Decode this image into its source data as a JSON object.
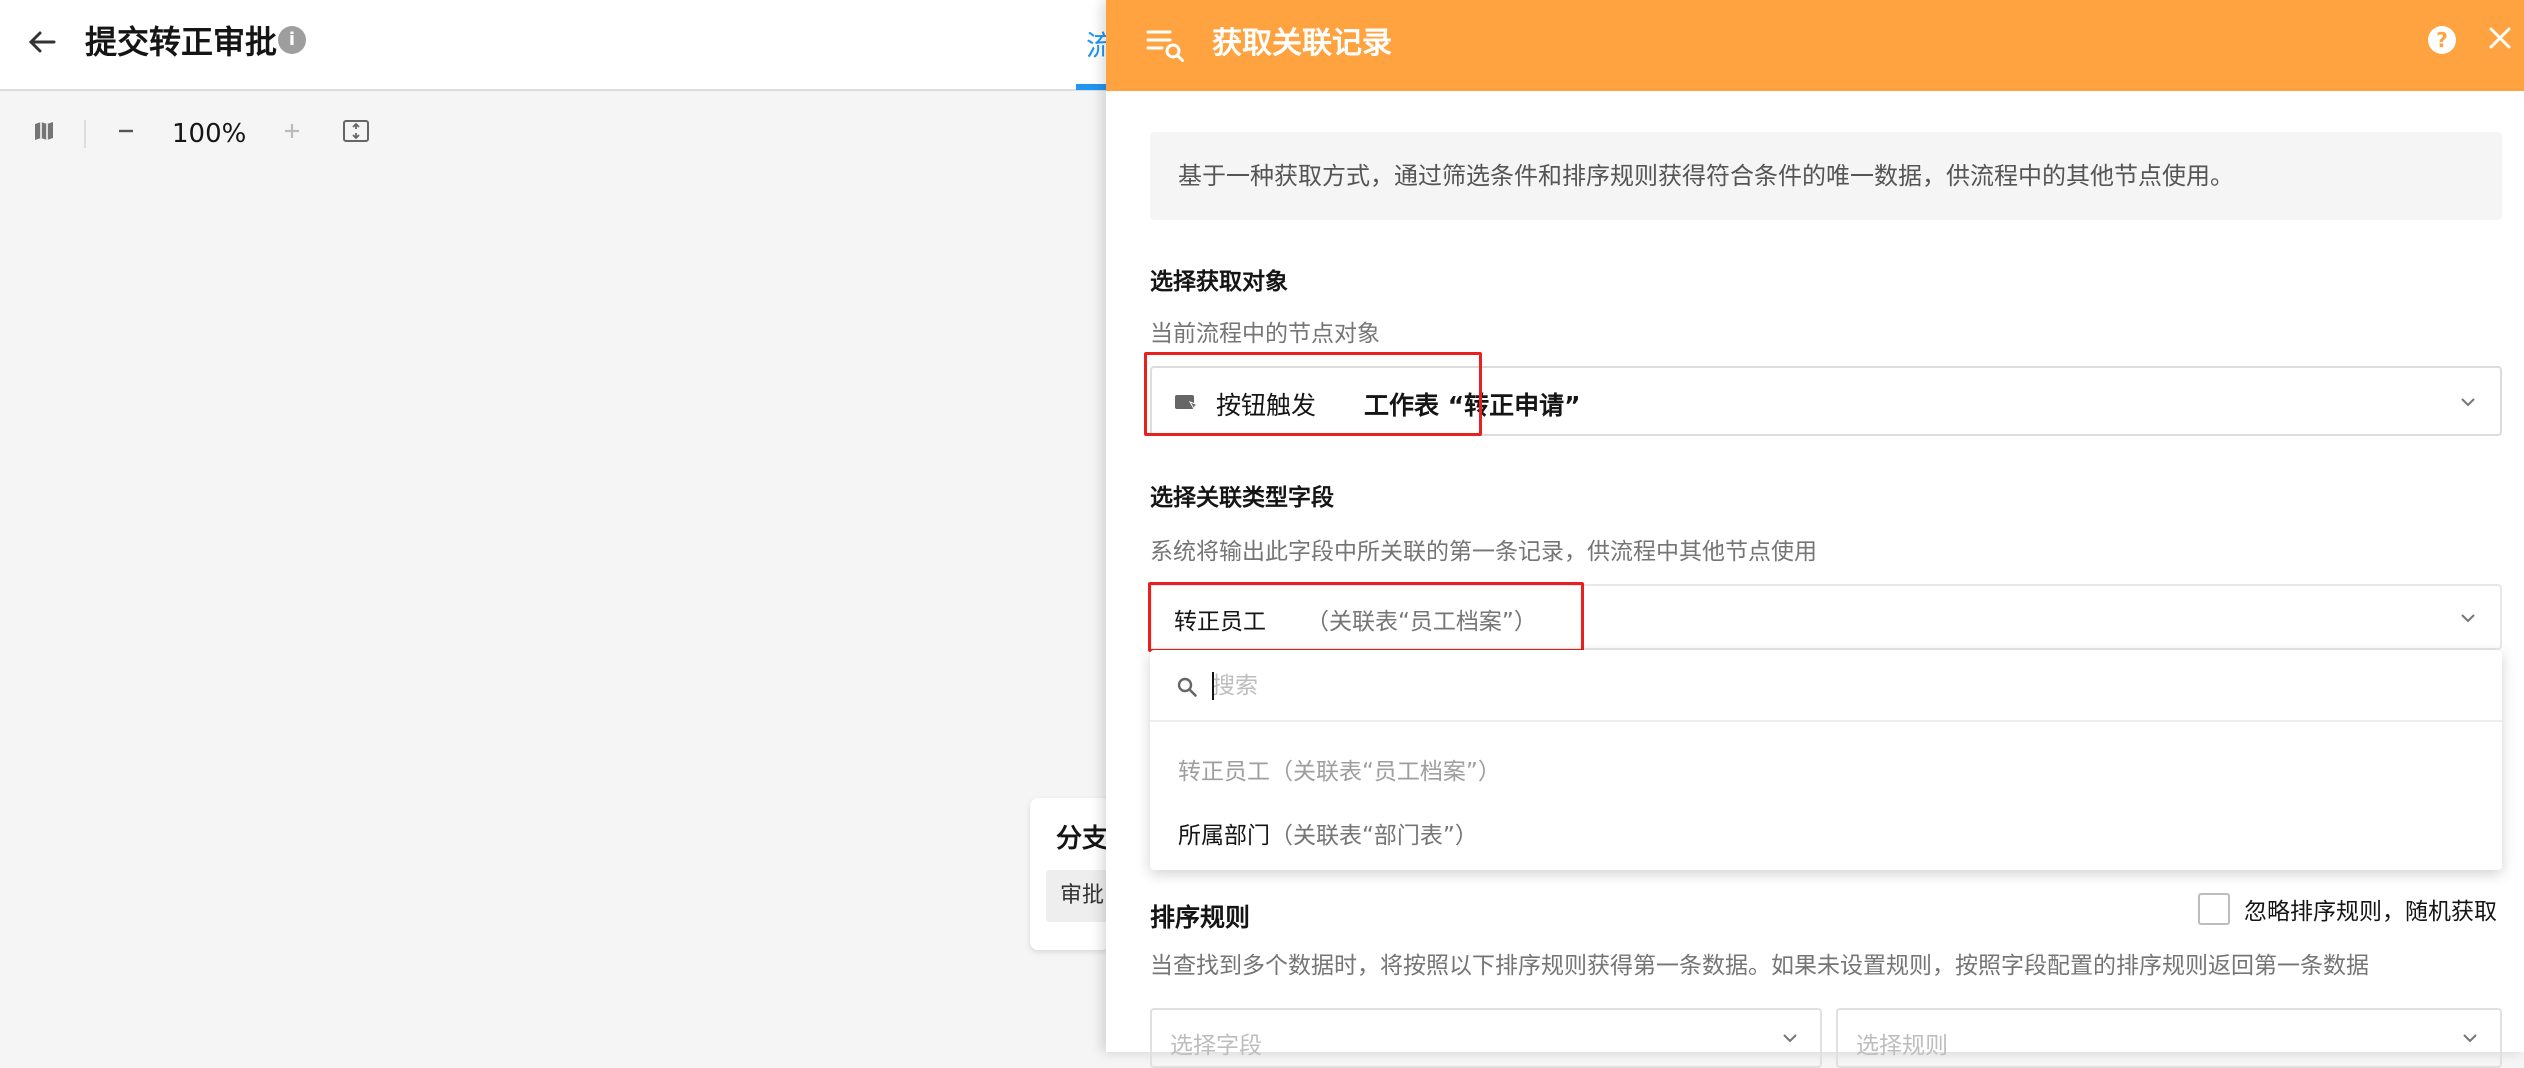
{
  "header": {
    "back_icon": "arrow-left-icon",
    "title": "提交转正审批",
    "info_icon": "info-icon",
    "flow_tab": "流"
  },
  "toolbar": {
    "map_icon": "map-icon",
    "zoom_out_icon": "minus-icon",
    "zoom": "100%",
    "zoom_in_icon": "plus-icon",
    "fit_icon": "fit-screen-icon"
  },
  "canvas": {
    "branch_title": "分支",
    "branch_pill": "审批"
  },
  "drawer": {
    "title": "获取关联记录",
    "header_color": "#ffa340",
    "description": "基于一种获取方式，通过筛选条件和排序规则获得符合条件的唯一数据，供流程中的其他节点使用。",
    "object_section": {
      "title": "选择获取对象",
      "subtitle": "当前流程中的节点对象",
      "selected_label": "按钮触发",
      "selected_value": "工作表 “转正申请”"
    },
    "field_section": {
      "title": "选择关联类型字段",
      "subtitle": "系统将输出此字段中所关联的第一条记录，供流程中其他节点使用",
      "selected_name": "转正员工",
      "selected_rel": "（关联表“员工档案”）",
      "search_placeholder": "搜索",
      "options": [
        {
          "name": "转正员工",
          "rel": "（关联表“员工档案”）",
          "disabled": true
        },
        {
          "name": "所属部门",
          "rel": "（关联表“部门表”）",
          "disabled": false
        }
      ]
    },
    "sort_section": {
      "title": "排序规则",
      "ignore_label": "忽略排序规则，随机获取",
      "subtitle": "当查找到多个数据时，将按照以下排序规则获得第一条数据。如果未设置规则，按照字段配置的排序规则返回第一条数据",
      "field_placeholder": "选择字段",
      "rule_placeholder": "选择规则"
    },
    "highlight_color": "#e8201f"
  }
}
